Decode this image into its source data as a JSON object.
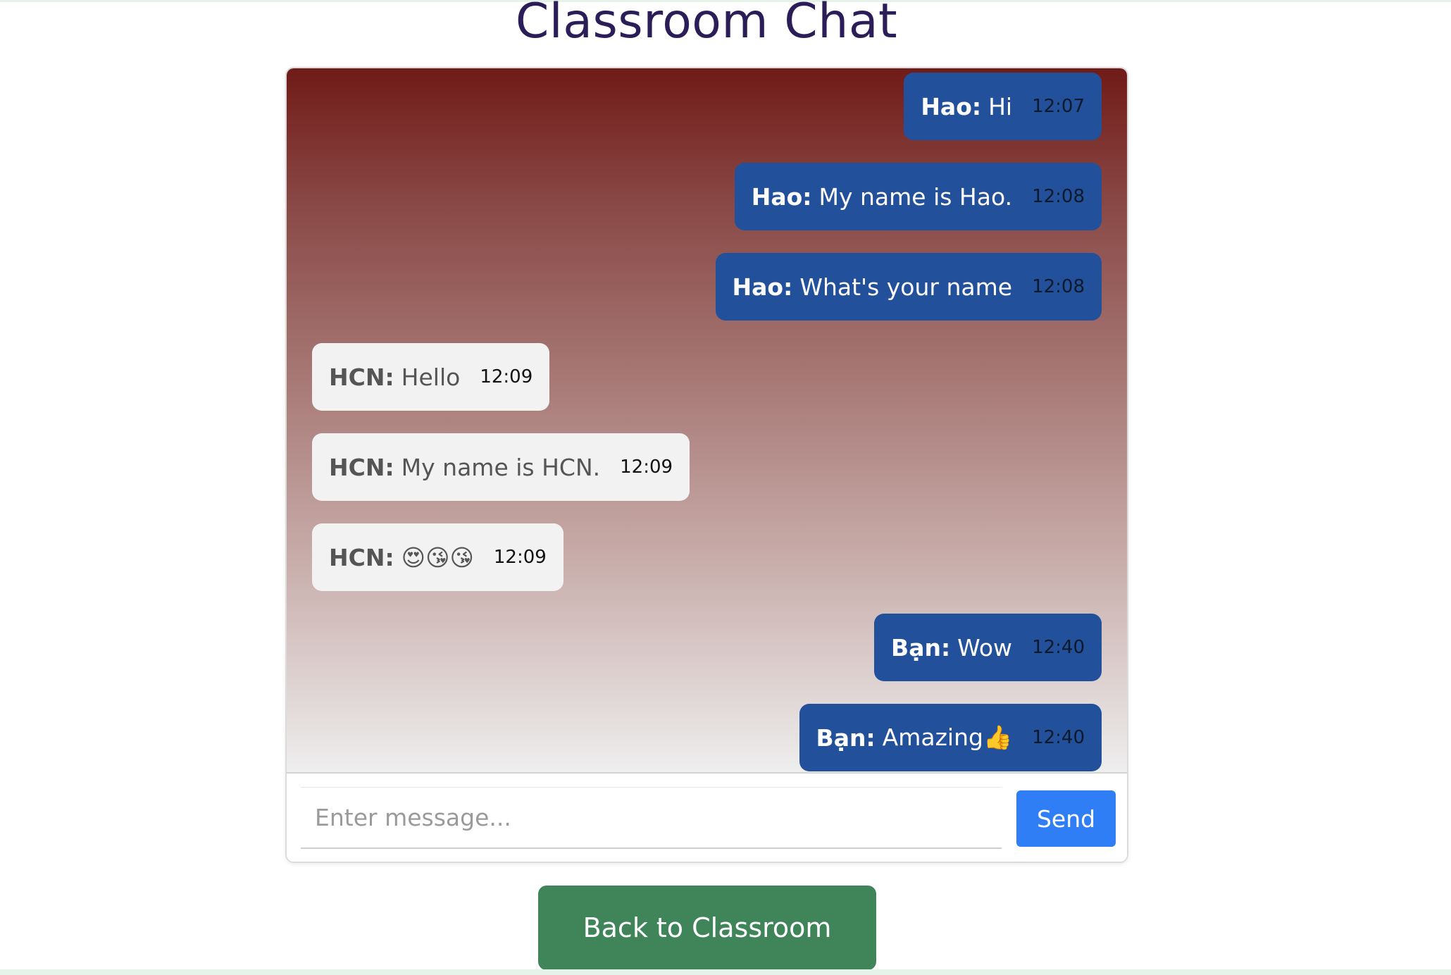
{
  "page": {
    "title": "Classroom Chat"
  },
  "messages": [
    {
      "direction": "out",
      "sender": "Hao",
      "text": "Hi",
      "time": "12:07"
    },
    {
      "direction": "out",
      "sender": "Hao",
      "text": "My name is Hao.",
      "time": "12:08"
    },
    {
      "direction": "out",
      "sender": "Hao",
      "text": "What's your name",
      "time": "12:08"
    },
    {
      "direction": "in",
      "sender": "HCN",
      "text": "Hello",
      "time": "12:09"
    },
    {
      "direction": "in",
      "sender": "HCN",
      "text": "My name is HCN.",
      "time": "12:09"
    },
    {
      "direction": "in",
      "sender": "HCN",
      "text": "😍😘😘",
      "time": "12:09"
    },
    {
      "direction": "out",
      "sender": "Bạn",
      "text": "Wow",
      "time": "12:40"
    },
    {
      "direction": "out",
      "sender": "Bạn",
      "text": "Amazing👍",
      "time": "12:40"
    }
  ],
  "composer": {
    "placeholder": "Enter message...",
    "value": "",
    "send_label": "Send"
  },
  "footer": {
    "back_label": "Back to Classroom"
  },
  "colors": {
    "title": "#2b1d57",
    "outgoing_bubble": "#22509a",
    "incoming_bubble": "#f2f2f2",
    "send_button": "#2f7ef5",
    "back_button": "#40845a",
    "gradient_top": "#701b18",
    "gradient_bottom": "#eeeeee"
  }
}
